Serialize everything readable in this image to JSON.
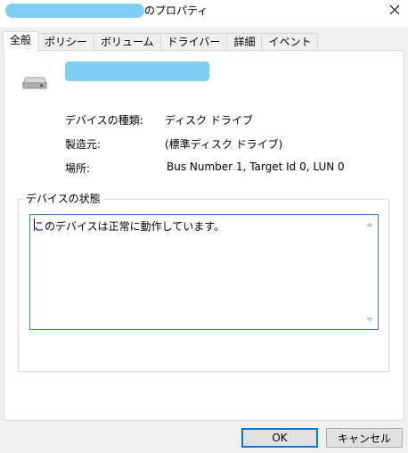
{
  "window": {
    "title_suffix": "のプロパティ",
    "close_glyph": "✕"
  },
  "tabs": [
    {
      "label": "全般",
      "active": true
    },
    {
      "label": "ポリシー"
    },
    {
      "label": "ボリューム"
    },
    {
      "label": "ドライバー"
    },
    {
      "label": "詳細"
    },
    {
      "label": "イベント"
    }
  ],
  "general": {
    "icon": "disk-drive-icon",
    "properties": [
      {
        "label": "デバイスの種類:",
        "value": "ディスク ドライブ"
      },
      {
        "label": "製造元:",
        "value": "(標準ディスク ドライブ)"
      },
      {
        "label": "場所:",
        "value": "Bus Number 1, Target Id 0, LUN 0"
      }
    ],
    "status_group_label": "デバイスの状態",
    "status_text": "このデバイスは正常に動作しています。"
  },
  "buttons": {
    "ok": "OK",
    "cancel": "キャンセル"
  },
  "colors": {
    "redaction": "#7fcff2",
    "focus_border": "#0078d7"
  }
}
